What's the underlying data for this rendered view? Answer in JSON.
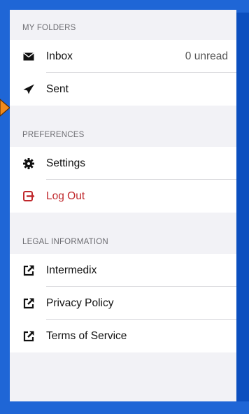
{
  "sections": [
    {
      "header": "MY FOLDERS",
      "items": [
        {
          "label": "Inbox",
          "detail": "0 unread",
          "icon": "envelope-icon"
        },
        {
          "label": "Sent",
          "icon": "paper-plane-icon"
        }
      ]
    },
    {
      "header": "PREFERENCES",
      "items": [
        {
          "label": "Settings",
          "icon": "gear-icon"
        },
        {
          "label": "Log Out",
          "icon": "logout-icon"
        }
      ]
    },
    {
      "header": "LEGAL INFORMATION",
      "items": [
        {
          "label": "Intermedix",
          "icon": "external-link-icon"
        },
        {
          "label": "Privacy Policy",
          "icon": "external-link-icon"
        },
        {
          "label": "Terms of Service",
          "icon": "external-link-icon"
        }
      ]
    }
  ],
  "colors": {
    "frame": "#0c4fbf",
    "background": "#1f66d6",
    "arrow": "#f08a1c",
    "logout": "#c0282c"
  }
}
